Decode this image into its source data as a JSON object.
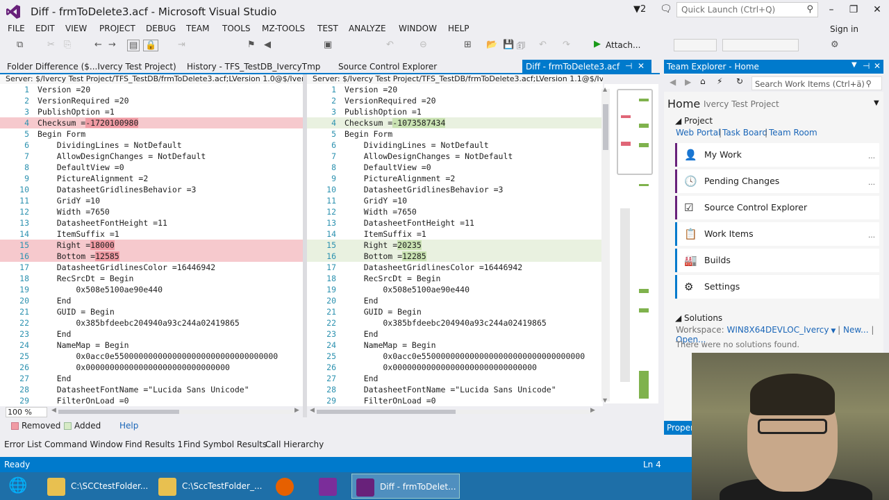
{
  "window": {
    "title": "Diff - frmToDelete3.acf - Microsoft Visual Studio",
    "filter_count": "2",
    "quick_launch_placeholder": "Quick Launch (Ctrl+Q)"
  },
  "menu": [
    "FILE",
    "EDIT",
    "VIEW",
    "PROJECT",
    "DEBUG",
    "TEAM",
    "TOOLS",
    "MZ-TOOLS",
    "TEST",
    "ANALYZE",
    "WINDOW",
    "HELP"
  ],
  "signin": "Sign in",
  "toolbar": {
    "attach_label": "Attach...",
    "icons": [
      "undo-icon",
      "redo-icon",
      "navigate-back-icon",
      "navigate-forward-icon",
      "save-icon",
      "save-all-icon",
      "start-icon",
      "comment-icon"
    ]
  },
  "tabs": {
    "folder_diff": "Folder Difference ($...Ivercy Test Project)",
    "history": "History - TFS_TestDB_IvercyTmp",
    "sce": "Source Control Explorer",
    "active": "Diff - frmToDelete3.acf"
  },
  "left": {
    "server": "Server: $/Ivercy Test Project/TFS_TestDB/frmToDelete3.acf;LVersion 1.0@$/Ivercy Test Project"
  },
  "right": {
    "server": "Server: $/Ivercy Test Project/TFS_TestDB/frmToDelete3.acf;LVersion 1.1@$/Ivercy Test Project"
  },
  "lines_left": [
    {
      "n": "1",
      "t": "Version =20"
    },
    {
      "n": "2",
      "t": "VersionRequired =20"
    },
    {
      "n": "3",
      "t": "PublishOption =1"
    },
    {
      "n": "4",
      "t": "Checksum =",
      "h": "-1720100980",
      "c": "rem"
    },
    {
      "n": "5",
      "t": "Begin Form"
    },
    {
      "n": "6",
      "t": "    DividingLines = NotDefault"
    },
    {
      "n": "7",
      "t": "    AllowDesignChanges = NotDefault"
    },
    {
      "n": "8",
      "t": "    DefaultView =0"
    },
    {
      "n": "9",
      "t": "    PictureAlignment =2"
    },
    {
      "n": "10",
      "t": "    DatasheetGridlinesBehavior =3"
    },
    {
      "n": "11",
      "t": "    GridY =10"
    },
    {
      "n": "12",
      "t": "    Width =7650"
    },
    {
      "n": "13",
      "t": "    DatasheetFontHeight =11"
    },
    {
      "n": "14",
      "t": "    ItemSuffix =1"
    },
    {
      "n": "15",
      "t": "    Right =",
      "h": "18000",
      "c": "rem"
    },
    {
      "n": "16",
      "t": "    Bottom =",
      "h": "12585",
      "c": "rem"
    },
    {
      "n": "17",
      "t": "    DatasheetGridlinesColor =16446942"
    },
    {
      "n": "18",
      "t": "    RecSrcDt = Begin"
    },
    {
      "n": "19",
      "t": "        0x508e5100ae90e440"
    },
    {
      "n": "20",
      "t": "    End"
    },
    {
      "n": "21",
      "t": "    GUID = Begin"
    },
    {
      "n": "22",
      "t": "        0x385bfdeebc204940a93c244a02419865"
    },
    {
      "n": "23",
      "t": "    End"
    },
    {
      "n": "24",
      "t": "    NameMap = Begin"
    },
    {
      "n": "25",
      "t": "        0x0acc0e5500000000000000000000000000000000"
    },
    {
      "n": "26",
      "t": "        0x000000000000000000000000000000"
    },
    {
      "n": "27",
      "t": "    End"
    },
    {
      "n": "28",
      "t": "    DatasheetFontName =\"Lucida Sans Unicode\""
    },
    {
      "n": "29",
      "t": "    FilterOnLoad =0"
    }
  ],
  "lines_right": [
    {
      "n": "1",
      "t": "Version =20"
    },
    {
      "n": "2",
      "t": "VersionRequired =20"
    },
    {
      "n": "3",
      "t": "PublishOption =1"
    },
    {
      "n": "4",
      "t": "Checksum =",
      "h": "-1073587434",
      "c": "add"
    },
    {
      "n": "5",
      "t": "Begin Form"
    },
    {
      "n": "6",
      "t": "    DividingLines = NotDefault"
    },
    {
      "n": "7",
      "t": "    AllowDesignChanges = NotDefault"
    },
    {
      "n": "8",
      "t": "    DefaultView =0"
    },
    {
      "n": "9",
      "t": "    PictureAlignment =2"
    },
    {
      "n": "10",
      "t": "    DatasheetGridlinesBehavior =3"
    },
    {
      "n": "11",
      "t": "    GridY =10"
    },
    {
      "n": "12",
      "t": "    Width =7650"
    },
    {
      "n": "13",
      "t": "    DatasheetFontHeight =11"
    },
    {
      "n": "14",
      "t": "    ItemSuffix =1"
    },
    {
      "n": "15",
      "t": "    Right =",
      "h": "20235",
      "c": "add"
    },
    {
      "n": "16",
      "t": "    Bottom =",
      "h": "12285",
      "c": "add"
    },
    {
      "n": "17",
      "t": "    DatasheetGridlinesColor =16446942"
    },
    {
      "n": "18",
      "t": "    RecSrcDt = Begin"
    },
    {
      "n": "19",
      "t": "        0x508e5100ae90e440"
    },
    {
      "n": "20",
      "t": "    End"
    },
    {
      "n": "21",
      "t": "    GUID = Begin"
    },
    {
      "n": "22",
      "t": "        0x385bfdeebc204940a93c244a02419865"
    },
    {
      "n": "23",
      "t": "    End"
    },
    {
      "n": "24",
      "t": "    NameMap = Begin"
    },
    {
      "n": "25",
      "t": "        0x0acc0e5500000000000000000000000000000000"
    },
    {
      "n": "26",
      "t": "        0x000000000000000000000000000000"
    },
    {
      "n": "27",
      "t": "    End"
    },
    {
      "n": "28",
      "t": "    DatasheetFontName =\"Lucida Sans Unicode\""
    },
    {
      "n": "29",
      "t": "    FilterOnLoad =0"
    }
  ],
  "zoom": "100 %",
  "legend": {
    "removed": "Removed",
    "added": "Added",
    "help": "Help"
  },
  "team": {
    "header": "Team Explorer - Home",
    "search_placeholder": "Search Work Items (Ctrl+ä)",
    "home": "Home",
    "project_name": "Ivercy Test Project",
    "project_section": "Project",
    "links": [
      "Web Portal",
      "Task Board",
      "Team Room"
    ],
    "tiles": [
      "My Work",
      "Pending Changes",
      "Source Control Explorer",
      "Work Items",
      "Builds",
      "Settings"
    ],
    "solutions": "Solutions",
    "workspace_label": "Workspace:",
    "workspace": "WIN8X64DEVLOC_Ivercy",
    "new": "New...",
    "open": "Open...",
    "no_solutions": "There were no solutions found.",
    "properties": "Proper"
  },
  "bottom_tabs": [
    "Error List",
    "Command Window",
    "Find Results 1",
    "Find Symbol Results",
    "Call Hierarchy"
  ],
  "status": {
    "ready": "Ready",
    "ln": "Ln 4"
  },
  "taskbar": [
    "C:\\SCCtestFolder...",
    "C:\\SccTestFolder_...",
    "Diff - frmToDelet..."
  ],
  "colors": {
    "accent": "#007acc",
    "removed": "#f6c9cd",
    "added": "#e9f1e0"
  }
}
